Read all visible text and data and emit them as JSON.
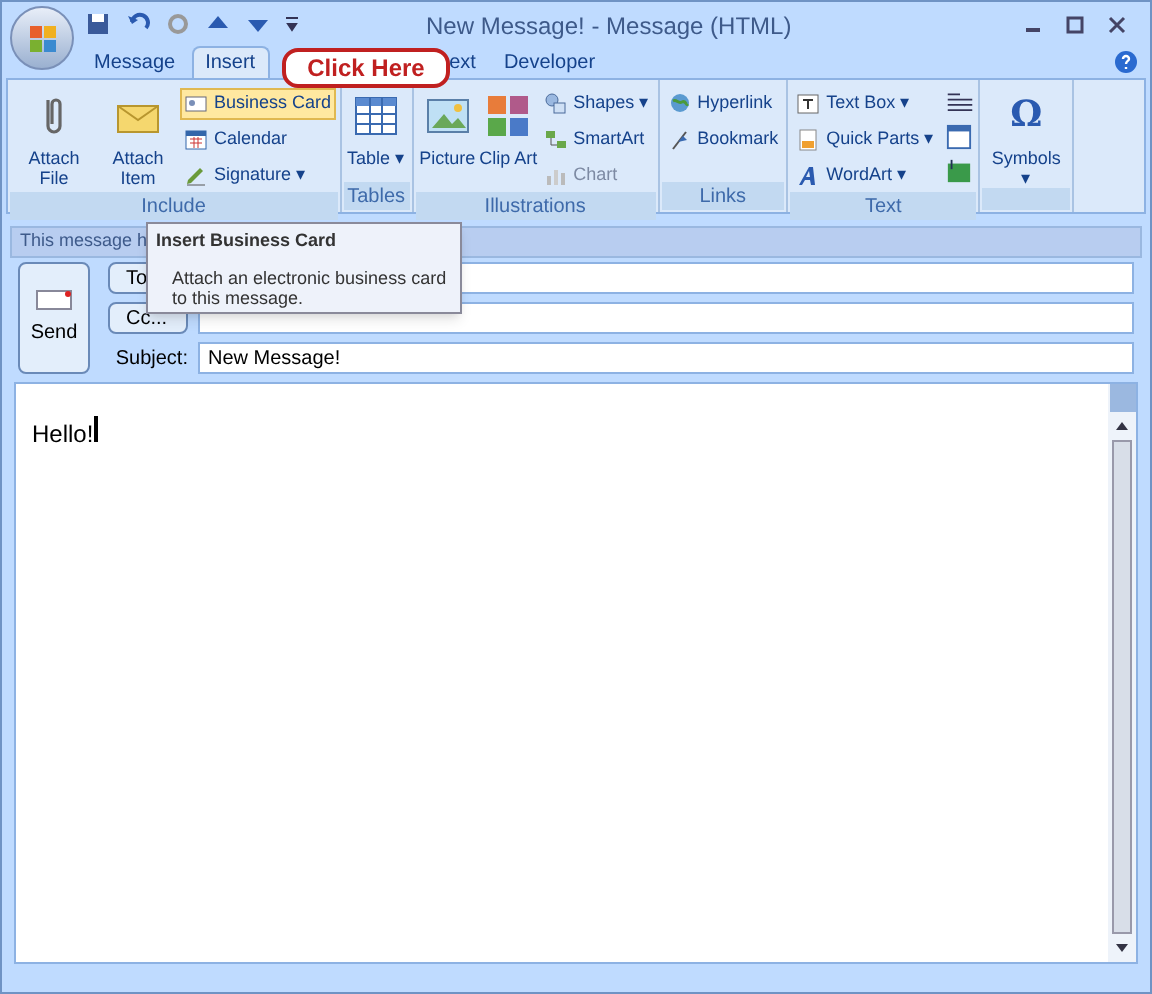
{
  "window": {
    "title": "New Message! - Message (HTML)"
  },
  "tabs": [
    {
      "label": "Message",
      "selected": false
    },
    {
      "label": "Insert",
      "selected": true
    },
    {
      "label": "ext",
      "selected": false
    },
    {
      "label": "Developer",
      "selected": false
    }
  ],
  "ribbon": {
    "groups": [
      {
        "label": "Include",
        "large": [
          {
            "label": "Attach File"
          },
          {
            "label": "Attach Item"
          }
        ],
        "small": [
          {
            "label": "Business Card",
            "hovered": true,
            "disabled": false
          },
          {
            "label": "Calendar",
            "hovered": false,
            "disabled": false
          },
          {
            "label": "Signature ▾",
            "hovered": false,
            "disabled": false
          }
        ]
      },
      {
        "label": "Tables",
        "large": [
          {
            "label": "Table ▾"
          }
        ]
      },
      {
        "label": "Illustrations",
        "large": [
          {
            "label": "Picture"
          },
          {
            "label": "Clip Art"
          }
        ],
        "small": [
          {
            "label": "Shapes ▾",
            "hovered": false,
            "disabled": false
          },
          {
            "label": "SmartArt",
            "hovered": false,
            "disabled": false
          },
          {
            "label": "Chart",
            "hovered": false,
            "disabled": true
          }
        ]
      },
      {
        "label": "Links",
        "small": [
          {
            "label": "Hyperlink",
            "hovered": false,
            "disabled": false
          },
          {
            "label": "Bookmark",
            "hovered": false,
            "disabled": false
          }
        ]
      },
      {
        "label": "Text",
        "small": [
          {
            "label": "Text Box ▾",
            "hovered": false,
            "disabled": false
          },
          {
            "label": "Quick Parts ▾",
            "hovered": false,
            "disabled": false
          },
          {
            "label": "WordArt ▾",
            "hovered": false,
            "disabled": false
          }
        ]
      },
      {
        "large": [
          {
            "label": "Symbols ▾",
            "glyph": "Ω"
          }
        ]
      }
    ]
  },
  "callout": {
    "text": "Click Here"
  },
  "tooltip": {
    "title": "Insert Business Card",
    "body": "Attach an electronic business card to this message."
  },
  "info_bar": {
    "text": "This message h"
  },
  "send_button": {
    "label": "Send"
  },
  "fields": [
    {
      "kind": "button",
      "label": "To"
    },
    {
      "kind": "button",
      "label": "Cc..."
    },
    {
      "kind": "label",
      "label": "Subject:",
      "value": "New Message!"
    }
  ],
  "body": {
    "text": "Hello!"
  }
}
